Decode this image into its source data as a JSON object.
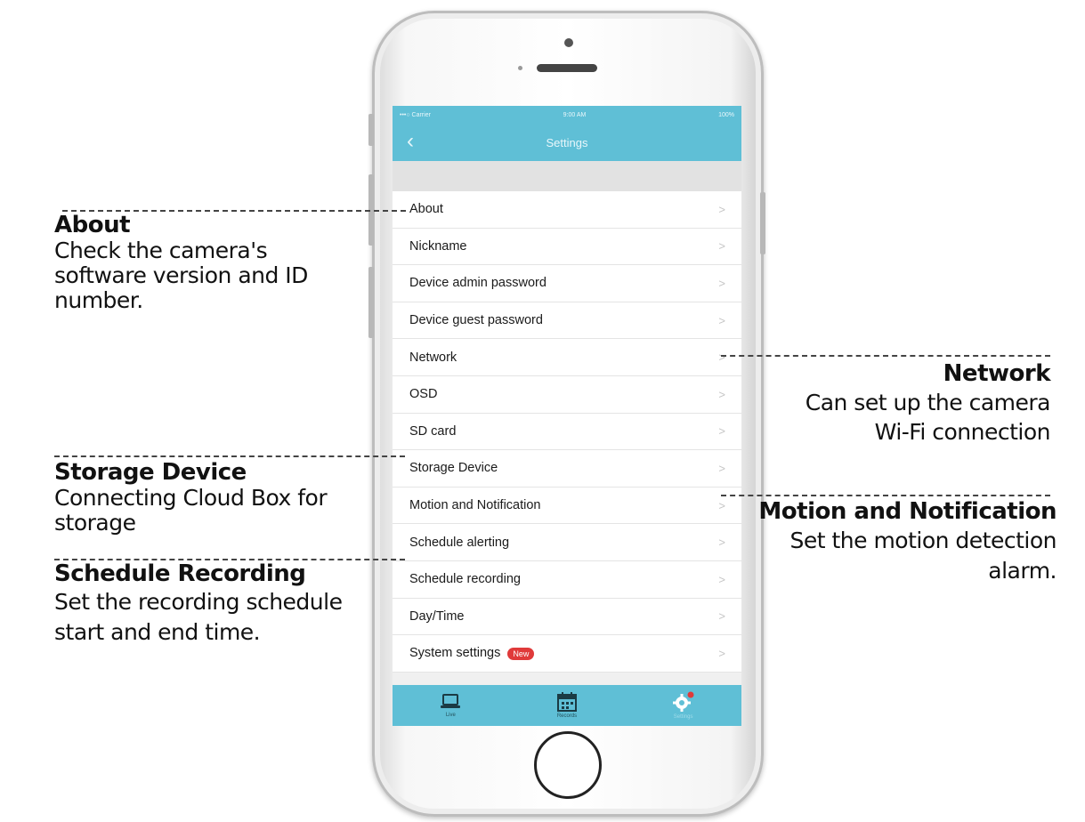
{
  "screen": {
    "status": {
      "carrier": "•••○ Carrier",
      "time": "9:00 AM",
      "battery": "100%"
    },
    "nav": {
      "back_icon": "chevron-left-icon",
      "title": "Settings"
    },
    "menu": [
      {
        "label": "About"
      },
      {
        "label": "Nickname"
      },
      {
        "label": "Device admin password"
      },
      {
        "label": "Device guest password"
      },
      {
        "label": "Network"
      },
      {
        "label": "OSD"
      },
      {
        "label": "SD card"
      },
      {
        "label": "Storage Device"
      },
      {
        "label": "Motion and Notification"
      },
      {
        "label": "Schedule alerting"
      },
      {
        "label": "Schedule recording"
      },
      {
        "label": "Day/Time"
      },
      {
        "label": "System settings",
        "badge": "New"
      }
    ],
    "chevron": ">",
    "tabs": [
      {
        "label": "Live",
        "icon": "laptop-icon"
      },
      {
        "label": "Records",
        "icon": "calendar-icon"
      },
      {
        "label": "Settings",
        "icon": "gear-icon"
      }
    ],
    "colors": {
      "accent": "#5fbfd6",
      "badge": "#e03a3a"
    }
  },
  "annotations": {
    "about": {
      "title": "About",
      "desc_lines": [
        "Check the camera's",
        "software version and ID",
        "number."
      ]
    },
    "storage": {
      "title": "Storage Device",
      "desc_lines": [
        "Connecting Cloud Box for",
        "storage"
      ]
    },
    "schedule": {
      "title": "Schedule Recording",
      "desc_lines": [
        "Set the recording schedule",
        "start and end time."
      ]
    },
    "network": {
      "title": "Network",
      "desc_lines": [
        "Can set up the camera",
        "Wi-Fi connection"
      ]
    },
    "motion": {
      "title": "Motion and Notification",
      "desc_lines": [
        "Set the motion detection",
        "alarm."
      ]
    }
  }
}
